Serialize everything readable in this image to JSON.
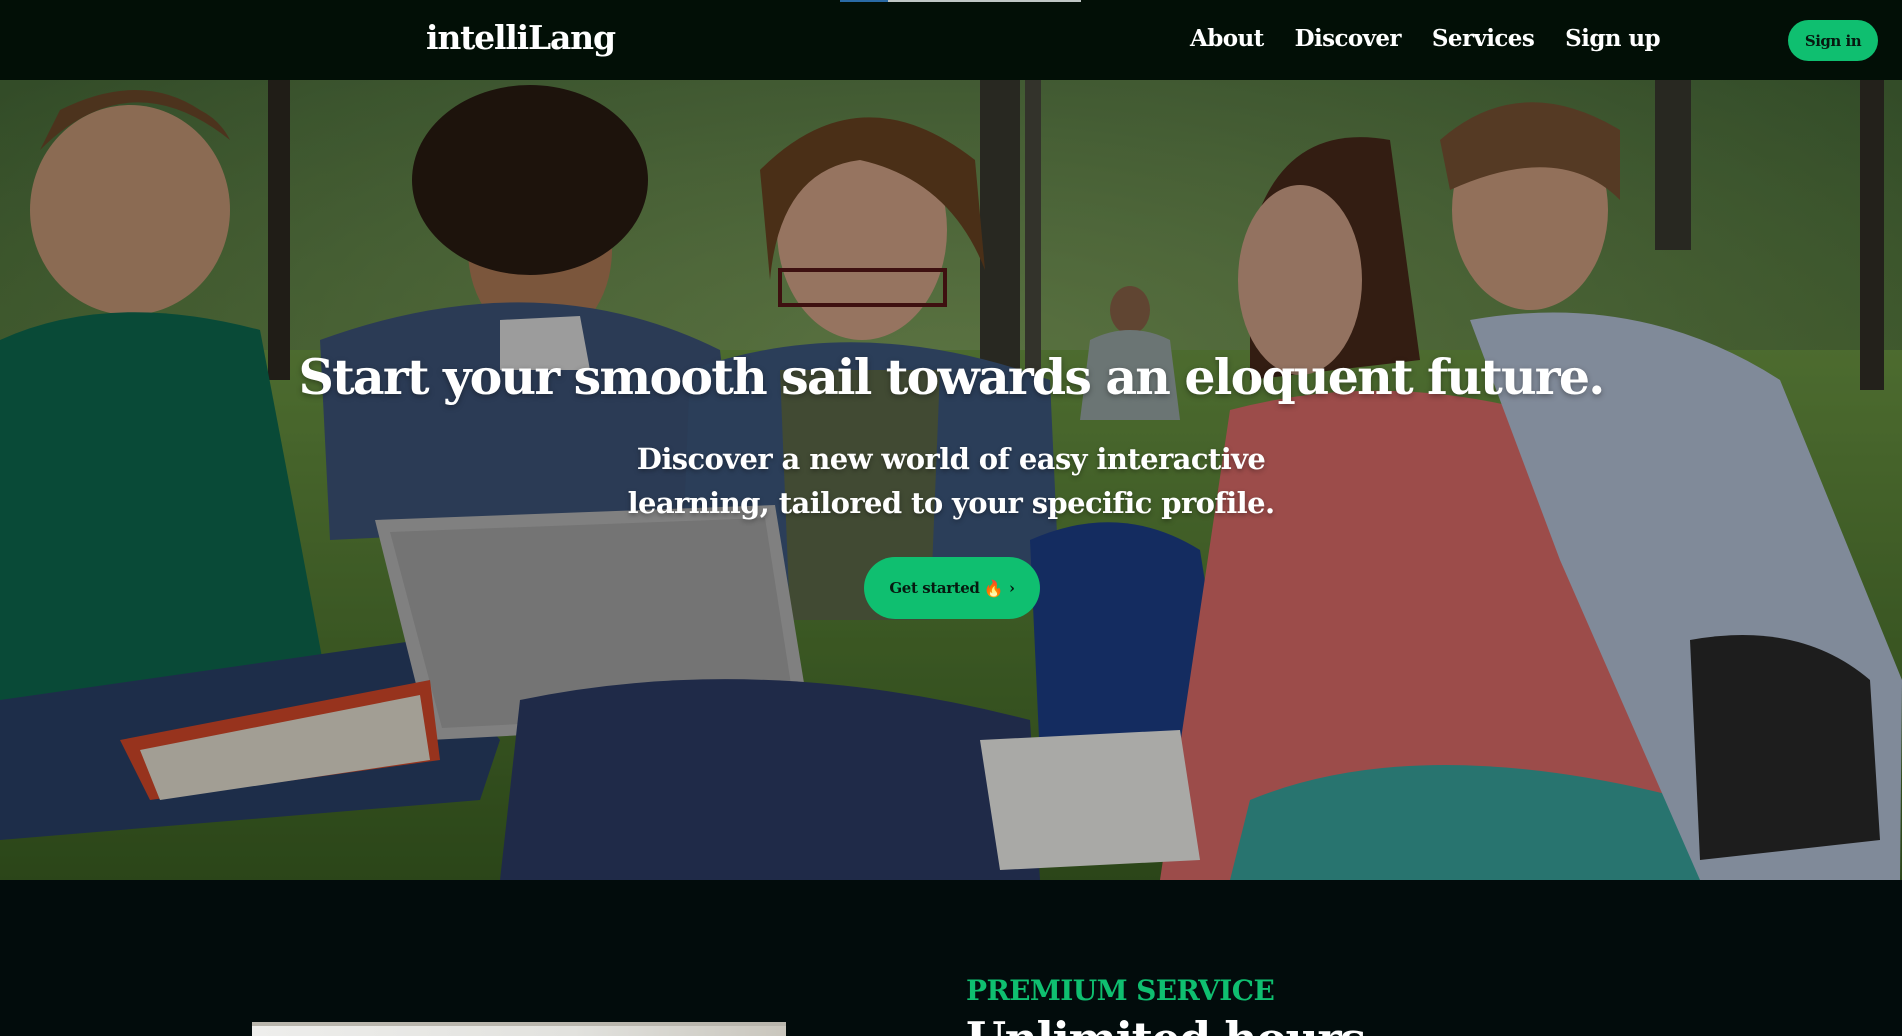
{
  "brand": {
    "name": "intelliLang"
  },
  "nav": {
    "links": [
      "About",
      "Discover",
      "Services",
      "Sign up"
    ],
    "signin_label": "Sign in"
  },
  "hero": {
    "title": "Start your smooth sail towards an eloquent future.",
    "subtitle_line1": "Discover a new world of easy interactive",
    "subtitle_line2": "learning, tailored to your specific profile.",
    "cta_label": "Get started",
    "cta_emoji": "🔥",
    "cta_chevron": "›",
    "background_image": "students-studying-outdoors-photo"
  },
  "section": {
    "eyebrow": "PREMIUM SERVICE",
    "heading": "Unlimited hours"
  },
  "colors": {
    "nav_bg": "#020f06",
    "accent": "#0fbf70",
    "page_bg": "#020c0c",
    "text_light": "#ffffff"
  },
  "icons": {
    "cta_icon": "fire-icon",
    "cta_arrow": "chevron-right-icon"
  }
}
